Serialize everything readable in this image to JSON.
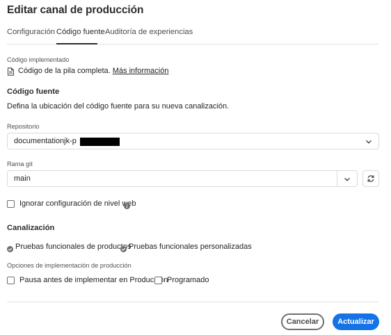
{
  "dialog": {
    "title": "Editar canal de producción"
  },
  "tabs": [
    {
      "label": "Configuración"
    },
    {
      "label": "Código fuente"
    },
    {
      "label": "Auditoría de experiencias"
    }
  ],
  "deployed_code": {
    "label": "Código implementado",
    "text": "Código de la pila completa.",
    "link": "Más información"
  },
  "source_code": {
    "title": "Código fuente",
    "description": "Defina la ubicación del código fuente para su nueva canalización."
  },
  "repository": {
    "label": "Repositorio",
    "value": "documentationjk-p"
  },
  "git_branch": {
    "label": "Rama git",
    "value": "main"
  },
  "ignore_web_tier": {
    "label": "Ignorar configuración de nivel web",
    "checked": false
  },
  "pipeline": {
    "title": "Canalización",
    "items": [
      {
        "label": "Pruebas funcionales de productos"
      },
      {
        "label": "Pruebas funcionales personalizadas"
      }
    ]
  },
  "deployment_options": {
    "label": "Opciones de implementación de producción",
    "options": [
      {
        "label": "Pausa antes de implementar en Producción",
        "checked": false
      },
      {
        "label": "Programado",
        "checked": false
      }
    ]
  },
  "footer": {
    "cancel_label": "Cancelar",
    "update_label": "Actualizar"
  },
  "colors": {
    "accent": "#1473e6",
    "text": "#222222",
    "border": "#dadada"
  }
}
